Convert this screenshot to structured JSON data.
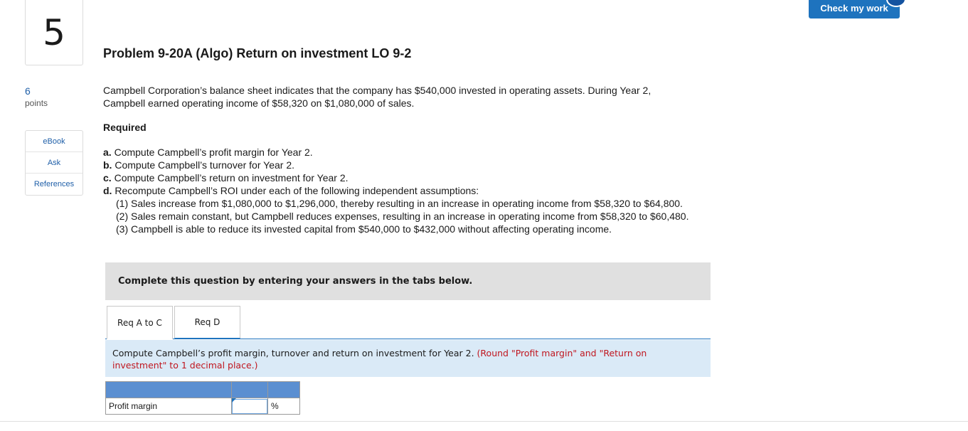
{
  "question": {
    "number": "5",
    "points": "6",
    "points_label": "points"
  },
  "tools": [
    {
      "label": "eBook"
    },
    {
      "label": "Ask"
    },
    {
      "label": "References"
    }
  ],
  "check_button": "Check my work",
  "problem": {
    "title": "Problem 9-20A (Algo) Return on investment LO 9-2",
    "intro_line1": "Campbell Corporation’s balance sheet indicates that the company has $540,000 invested in operating assets. During Year 2,",
    "intro_line2": "Campbell earned operating income of $58,320 on $1,080,000 of sales.",
    "required_label": "Required",
    "requirements": [
      {
        "letter": "a.",
        "text": " Compute Campbell’s profit margin for Year 2."
      },
      {
        "letter": "b.",
        "text": " Compute Campbell’s turnover for Year 2."
      },
      {
        "letter": "c.",
        "text": " Compute Campbell’s return on investment for Year 2."
      },
      {
        "letter": "d.",
        "text": " Recompute Campbell’s ROI under each of the following independent assumptions:"
      }
    ],
    "assumptions": [
      "(1) Sales increase from $1,080,000 to $1,296,000, thereby resulting in an increase in operating income from $58,320 to $64,800.",
      "(2) Sales remain constant, but Campbell reduces expenses, resulting in an increase in operating income from $58,320 to $60,480.",
      "(3) Campbell is able to reduce its invested capital from $540,000 to $432,000 without affecting operating income."
    ]
  },
  "tabs_header": "Complete this question by entering your answers in the tabs below.",
  "tabs": [
    {
      "label": "Req A to C"
    },
    {
      "label": "Req D"
    }
  ],
  "instruction": {
    "text": "Compute Campbell’s profit margin, turnover and return on investment for Year 2.",
    "note": "(Round \"Profit margin\" and \"Return on investment\" to 1 decimal place.)"
  },
  "answer_table": {
    "rows": [
      {
        "label": "Profit margin",
        "value": "",
        "unit": "%"
      }
    ]
  }
}
